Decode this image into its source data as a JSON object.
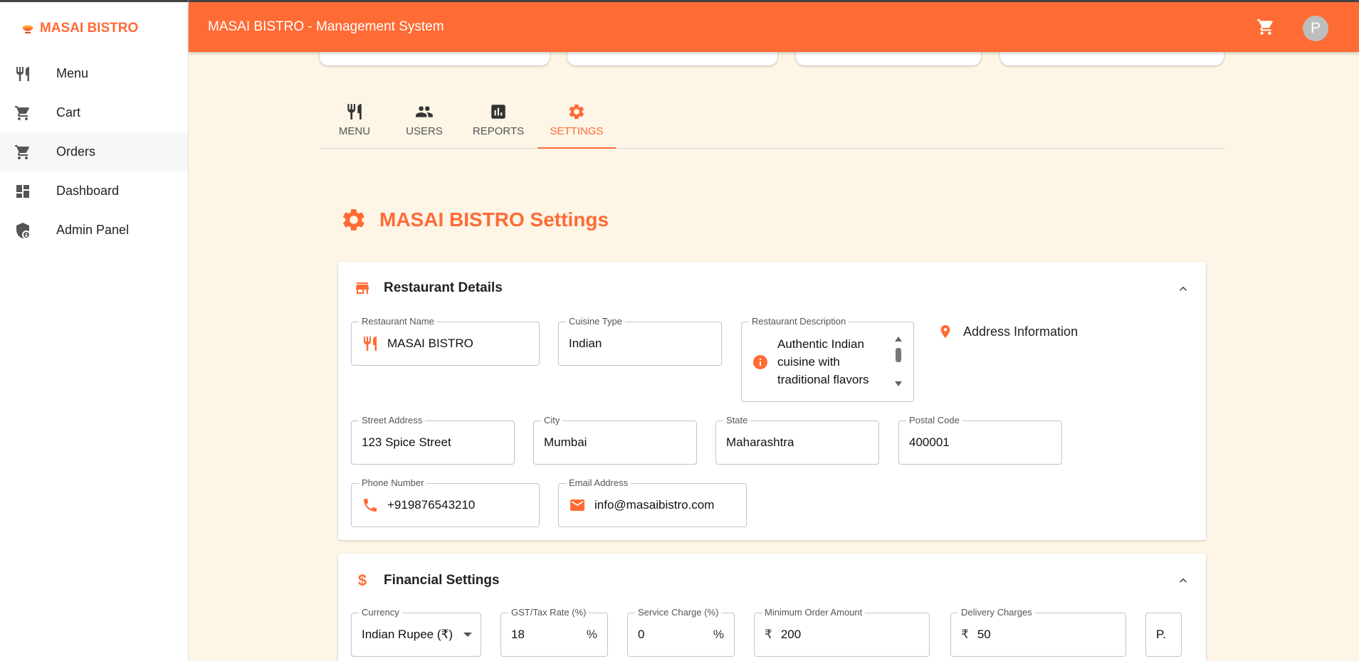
{
  "brand": {
    "name": "MASAI BISTRO",
    "icon": "bowl-icon"
  },
  "sidebar": {
    "items": [
      {
        "label": "Menu",
        "icon": "restaurant-icon"
      },
      {
        "label": "Cart",
        "icon": "cart-icon"
      },
      {
        "label": "Orders",
        "icon": "cart-icon"
      },
      {
        "label": "Dashboard",
        "icon": "dashboard-icon"
      },
      {
        "label": "Admin Panel",
        "icon": "admin-shield-icon"
      }
    ]
  },
  "header": {
    "title": "MASAI BISTRO - Management System",
    "avatar_initial": "P"
  },
  "tabs": [
    {
      "label": "MENU",
      "icon": "restaurant-icon"
    },
    {
      "label": "USERS",
      "icon": "users-icon"
    },
    {
      "label": "REPORTS",
      "icon": "reports-icon"
    },
    {
      "label": "SETTINGS",
      "icon": "gear-icon"
    }
  ],
  "settings": {
    "title": "MASAI BISTRO Settings"
  },
  "restaurant": {
    "heading": "Restaurant Details",
    "name_label": "Restaurant Name",
    "name_value": "MASAI BISTRO",
    "cuisine_label": "Cuisine Type",
    "cuisine_value": "Indian",
    "desc_label": "Restaurant Description",
    "desc_value": "Authentic Indian cuisine with traditional flavors",
    "address_heading": "Address Information",
    "street_label": "Street Address",
    "street_value": "123 Spice Street",
    "city_label": "City",
    "city_value": "Mumbai",
    "state_label": "State",
    "state_value": "Maharashtra",
    "postal_label": "Postal Code",
    "postal_value": "400001",
    "phone_label": "Phone Number",
    "phone_value": "+919876543210",
    "email_label": "Email Address",
    "email_value": "info@masaibistro.com"
  },
  "financial": {
    "heading": "Financial Settings",
    "currency_label": "Currency",
    "currency_value": "Indian Rupee (₹)",
    "gst_label": "GST/Tax Rate (%)",
    "gst_value": "18",
    "gst_suffix": "%",
    "service_label": "Service Charge (%)",
    "service_value": "0",
    "service_suffix": "%",
    "min_order_label": "Minimum Order Amount",
    "min_order_prefix": "₹",
    "min_order_value": "200",
    "delivery_label": "Delivery Charges",
    "delivery_prefix": "₹",
    "delivery_value": "50",
    "extra_value": "P."
  },
  "colors": {
    "accent": "#ff6b35",
    "background": "#fdf5e6"
  }
}
